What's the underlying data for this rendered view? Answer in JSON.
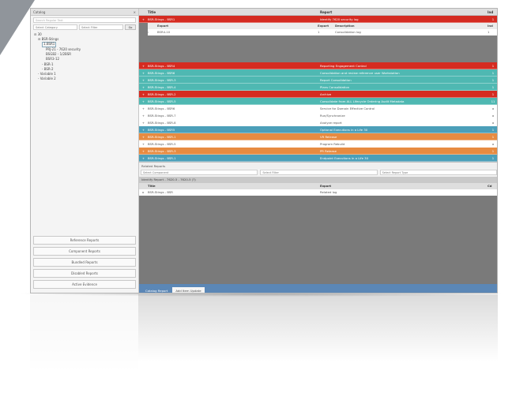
{
  "left_panel": {
    "header": "Catalog",
    "close": "×",
    "search_placeholder": "Search Regular Text",
    "filter_category": "Select Category",
    "filter_status": "Select Filter",
    "go_label": "Go",
    "tree": [
      {
        "text": "⊟ 30",
        "indent": 0
      },
      {
        "text": "⊟ BSR-Stings",
        "indent": 1
      },
      {
        "text": "1.BSR1",
        "indent": 2,
        "highlight": true
      },
      {
        "text": "PRJ-21 - 7620 security",
        "indent": 3
      },
      {
        "text": "BSGB2 - 1/2BSR",
        "indent": 3
      },
      {
        "text": "BSR3-12",
        "indent": 3
      },
      {
        "text": "- BSR-1",
        "indent": 2
      },
      {
        "text": "- BSR-2",
        "indent": 2
      },
      {
        "text": "- Variable 1",
        "indent": 1
      },
      {
        "text": "- Variable 2",
        "indent": 1
      }
    ],
    "nav_buttons": [
      "Reference Reports",
      "Component Reports",
      "Bundled Reports",
      "Disabled Reports",
      "Active Evidence"
    ]
  },
  "grid": {
    "col_title": "Title",
    "col_desc": "Report",
    "col_ind": "Ind",
    "rows": [
      {
        "style": "red",
        "title": "BSR-Stings - BSR1",
        "desc": "Identify 7620 security log",
        "ind": "1"
      },
      {
        "style": "red",
        "title": "BSR-Stings - BSR4",
        "desc": "Reporting Engagement Control",
        "ind": "1"
      },
      {
        "style": "teal",
        "title": "BSR-Stings - BSR6",
        "desc": "Consolidation and review reference user Workstation",
        "ind": "1"
      },
      {
        "style": "teal",
        "title": "BSR-Stings - BSR-3",
        "desc": "Report Consolidation",
        "ind": "1"
      },
      {
        "style": "teal",
        "title": "BSR-Stings - BSR-4",
        "desc": "Plans Consolidation",
        "ind": "1"
      },
      {
        "style": "red",
        "title": "BSR-Stings - BSR-2",
        "desc": "Archive",
        "ind": "1"
      },
      {
        "style": "teal",
        "title": "BSR-Stings - BSR-5",
        "desc": "Consolidate from ALL Lifecycle Ordering Audit Metadata",
        "ind": "11"
      },
      {
        "style": "white",
        "title": "BSR-Stings - BSR6",
        "desc": "Service for Domain Effective Control",
        "ind": "a"
      },
      {
        "style": "white",
        "title": "BSR-Stings - BSR-7",
        "desc": "Run/Synchronize",
        "ind": "a"
      },
      {
        "style": "white",
        "title": "BSR-Stings - BSR-8",
        "desc": "Analyze report",
        "ind": "a"
      },
      {
        "style": "steel",
        "title": "BSR-Stings - BSR5",
        "desc": "Optional Executions in a Life 30",
        "ind": "1"
      },
      {
        "style": "orange",
        "title": "BSR-Stings - BSR-1",
        "desc": "VR Release",
        "ind": "1"
      },
      {
        "style": "white",
        "title": "BSR-Stings - BSR-5",
        "desc": "Program Rebuild",
        "ind": "a"
      },
      {
        "style": "orange",
        "title": "BSR-Stings - BSR-3",
        "desc": "PR Release",
        "ind": "1"
      },
      {
        "style": "steel",
        "title": "BSR-Stings - BSR-1",
        "desc": "Endpoint Executions in a Life 30",
        "ind": "1"
      }
    ],
    "sub": {
      "col_a": "",
      "col_b": "Export",
      "col_c": "Export",
      "col_d": "Description",
      "col_e": "Ind",
      "row_b": "BSR4-10",
      "row_c": "1",
      "row_d": "Consolidation log",
      "row_e": "1"
    }
  },
  "related": {
    "title": "Related Reports",
    "filter1": "Select Component",
    "filter2": "Select Filter",
    "filter3": "Select Report Type",
    "header": "Identify Report - 7620-5 - 7620-5 (?)",
    "col_title": "Title",
    "col_desc": "Export",
    "col_ind": "Cd",
    "row_title": "BSR-Stings - BSR",
    "row_desc": "Related log",
    "row_ind": ""
  },
  "bottom_tabs": [
    "Catalog Report",
    "Add Item Update"
  ],
  "colors": {
    "red": "#d52b21",
    "teal": "#4fb8b2",
    "orange": "#e78b41",
    "steel": "#4b9fb9",
    "tab_bar": "#5b87b6"
  }
}
